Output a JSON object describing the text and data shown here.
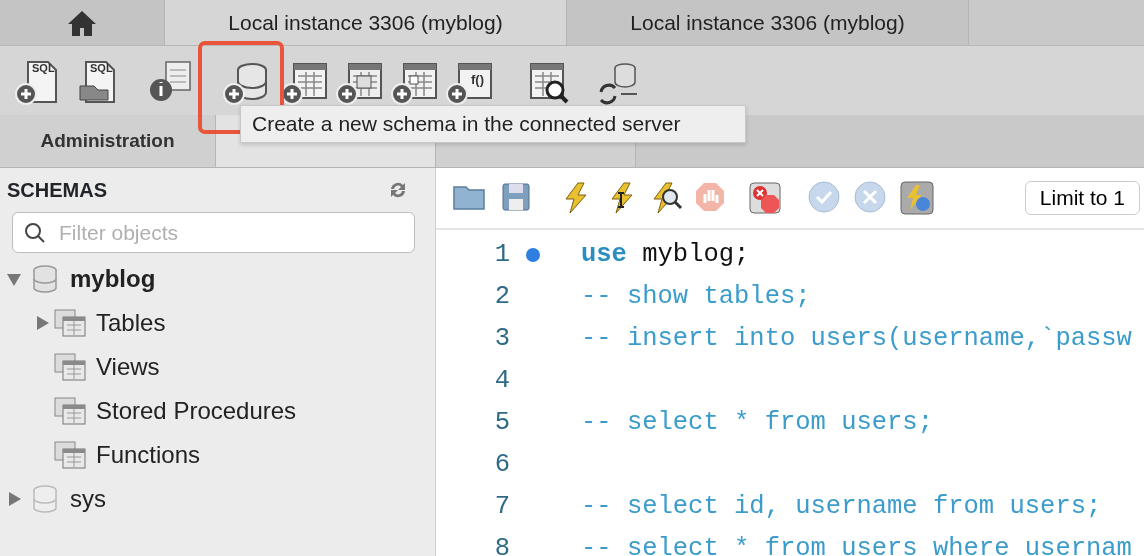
{
  "window_tabs": [
    {
      "kind": "home",
      "selected": false
    },
    {
      "label": "Local instance 3306 (myblog)",
      "selected": true
    },
    {
      "label": "Local instance 3306 (myblog)",
      "selected": false
    }
  ],
  "toolbar": [
    {
      "kind": "new-sql",
      "glyph": "SQL",
      "highlighted": false
    },
    {
      "kind": "open-sql",
      "glyph": "SQL",
      "highlighted": false
    },
    {
      "kind": "info",
      "highlighted": false
    },
    {
      "kind": "new-schema",
      "highlighted": true
    },
    {
      "kind": "new-table",
      "highlighted": false
    },
    {
      "kind": "new-view",
      "highlighted": false
    },
    {
      "kind": "new-procedure",
      "highlighted": false
    },
    {
      "kind": "new-function",
      "glyph": "f()",
      "highlighted": false
    },
    {
      "kind": "inspect",
      "highlighted": false
    },
    {
      "kind": "reconnect",
      "highlighted": false
    }
  ],
  "tooltip": "Create a new schema in the connected server",
  "panel_tabs": [
    {
      "label": "Administration",
      "selected": false
    },
    {
      "selected": true
    },
    {
      "selected": false
    }
  ],
  "sidebar": {
    "title": "SCHEMAS",
    "filter": {
      "placeholder": "Filter objects"
    },
    "schemas": [
      {
        "name": "myblog",
        "default": true,
        "expanded": true,
        "children": [
          {
            "name": "Tables",
            "expandable": true
          },
          {
            "name": "Views",
            "expandable": false
          },
          {
            "name": "Stored Procedures",
            "expandable": false
          },
          {
            "name": "Functions",
            "expandable": false
          }
        ]
      },
      {
        "name": "sys",
        "default": false,
        "expanded": false
      }
    ]
  },
  "editor": {
    "limit_button": "Limit to 1",
    "lines": [
      {
        "number": "1",
        "breakpoint": true,
        "tokens": [
          {
            "text": "use",
            "kind": "keyword"
          },
          {
            "text": " myblog;",
            "kind": "plain"
          }
        ]
      },
      {
        "number": "2",
        "breakpoint": false,
        "tokens": [
          {
            "text": "-- show tables;",
            "kind": "comment"
          }
        ]
      },
      {
        "number": "3",
        "breakpoint": false,
        "tokens": [
          {
            "text": "-- insert into users(username,`passw",
            "kind": "comment"
          }
        ]
      },
      {
        "number": "4",
        "breakpoint": false
      },
      {
        "number": "5",
        "breakpoint": false,
        "tokens": [
          {
            "text": "-- select * from users;",
            "kind": "comment"
          }
        ]
      },
      {
        "number": "6",
        "breakpoint": false
      },
      {
        "number": "7",
        "breakpoint": false,
        "tokens": [
          {
            "text": "-- select id, username from users;",
            "kind": "comment"
          }
        ]
      },
      {
        "number": "8",
        "breakpoint": false,
        "tokens": [
          {
            "text": "-- select * from users where usernam",
            "kind": "comment"
          }
        ]
      }
    ]
  }
}
